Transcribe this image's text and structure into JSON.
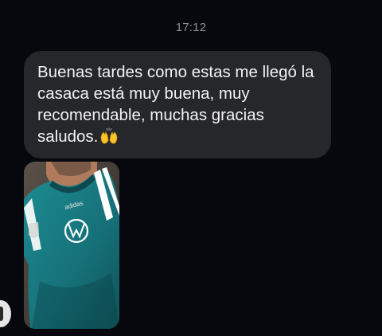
{
  "conversation": {
    "timestamp": "17:12",
    "message": {
      "text": "Buenas tardes como estas me llegó la casaca está muy buena, muy recomendable, muchas gracias saludos.",
      "emoji_icon": "raising-hands-icon"
    },
    "photo": {
      "jersey_brand_text": "adidas",
      "jersey_color": "#1c7f86",
      "stripe_color": "#ffffff"
    }
  },
  "colors": {
    "background": "#06080d",
    "bubble": "#26272b",
    "text": "#f2f2f4",
    "timestamp": "#8d9099"
  }
}
